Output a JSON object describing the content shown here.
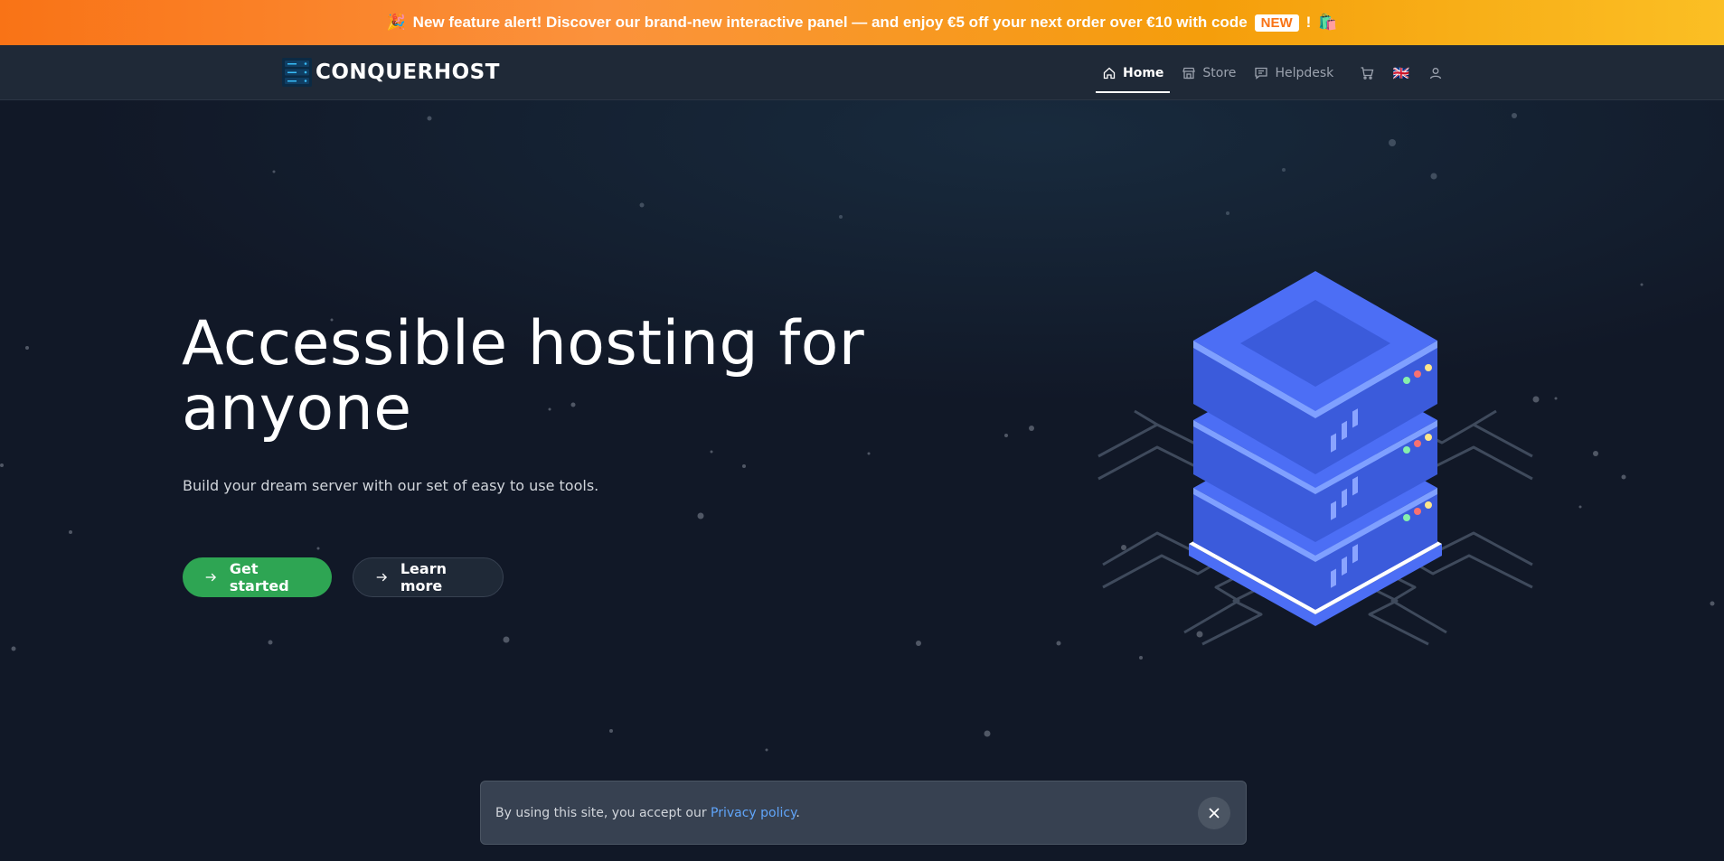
{
  "banner": {
    "emoji_start": "🎉",
    "text": "New feature alert! Discover our brand-new interactive panel — and enjoy €5 off your next order over €10 with code",
    "badge": "NEW",
    "text_end": "!",
    "emoji_end": "🛍️"
  },
  "nav": {
    "logo_text": "CONQUERHOST",
    "items": [
      {
        "label": "Home",
        "icon": "home-icon",
        "active": true
      },
      {
        "label": "Store",
        "icon": "store-icon",
        "active": false
      },
      {
        "label": "Helpdesk",
        "icon": "chat-icon",
        "active": false
      }
    ],
    "cart_icon": "cart-icon",
    "language_flag": "🇬🇧",
    "account_icon": "user-icon"
  },
  "hero": {
    "title": "Accessible hosting for anyone",
    "subtitle": "Build your dream server with our set of easy to use tools.",
    "primary_button": "Get started",
    "secondary_button": "Learn more"
  },
  "cookie": {
    "text": "By using this site, you accept our ",
    "link": "Privacy policy",
    "end": ".",
    "close_icon": "close-icon"
  },
  "colors": {
    "background": "#111827",
    "navbar": "#1f2937",
    "banner_start": "#f97316",
    "banner_end": "#fbbf24",
    "primary_button": "#2ea553",
    "server_blue": "#3b5bdb",
    "link": "#60a5fa"
  }
}
